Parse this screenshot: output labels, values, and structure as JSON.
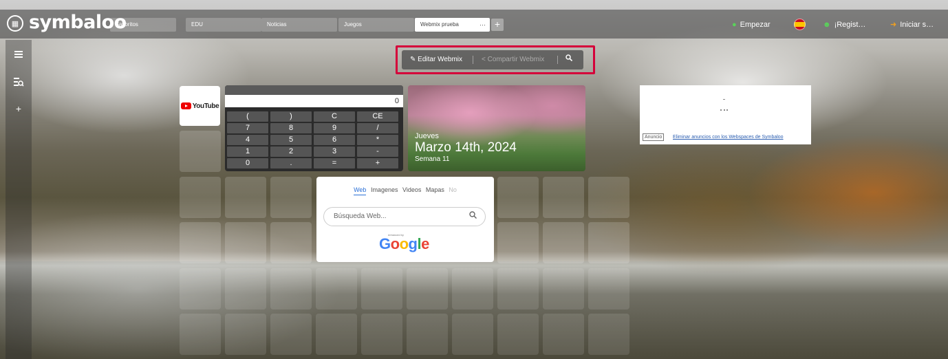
{
  "brand": {
    "logo_text": "symbaloo"
  },
  "tabs": [
    {
      "label": "Favoritos",
      "active": false
    },
    {
      "label": "EDU",
      "active": false
    },
    {
      "label": "Noticias",
      "active": false
    },
    {
      "label": "Juegos",
      "active": false
    },
    {
      "label": "Webmix prueba",
      "active": true,
      "menu": "···"
    }
  ],
  "add_tab_label": "+",
  "topright": {
    "start_label": "Empezar",
    "register_label": "¡Regist…",
    "login_label": "Iniciar s…",
    "language_flag": "spain-flag-icon"
  },
  "sidebar": {
    "list_icon": "list-icon",
    "eq_icon": "eq-icon",
    "add_label": "+"
  },
  "editbar": {
    "edit_label": "Editar Webmix",
    "share_label": "Compartir Webmix"
  },
  "youtube_tile": {
    "label": "YouTube"
  },
  "calculator": {
    "display": "0",
    "keys": [
      [
        "(",
        ")",
        "C",
        "CE"
      ],
      [
        "7",
        "8",
        "9",
        "/"
      ],
      [
        "4",
        "5",
        "6",
        "*"
      ],
      [
        "1",
        "2",
        "3",
        "-"
      ],
      [
        "0",
        ".",
        "=",
        "+"
      ]
    ]
  },
  "date_widget": {
    "day": "Jueves",
    "date": "Marzo 14th, 2024",
    "week": "Semana 11"
  },
  "ad": {
    "label": "Anuncio",
    "link": "Eliminar anuncios con los Webspaces de Symbaloo"
  },
  "search_widget": {
    "tabs": [
      "Web",
      "Imagenes",
      "Videos",
      "Mapas",
      "No"
    ],
    "active_tab": "Web",
    "placeholder": "Búsqueda Web...",
    "enhanced_by": "enhanced by",
    "engine": "Google"
  },
  "colors": {
    "accent_frame": "#d5003a",
    "link": "#2a5db0",
    "search_active": "#2a6fd6"
  }
}
